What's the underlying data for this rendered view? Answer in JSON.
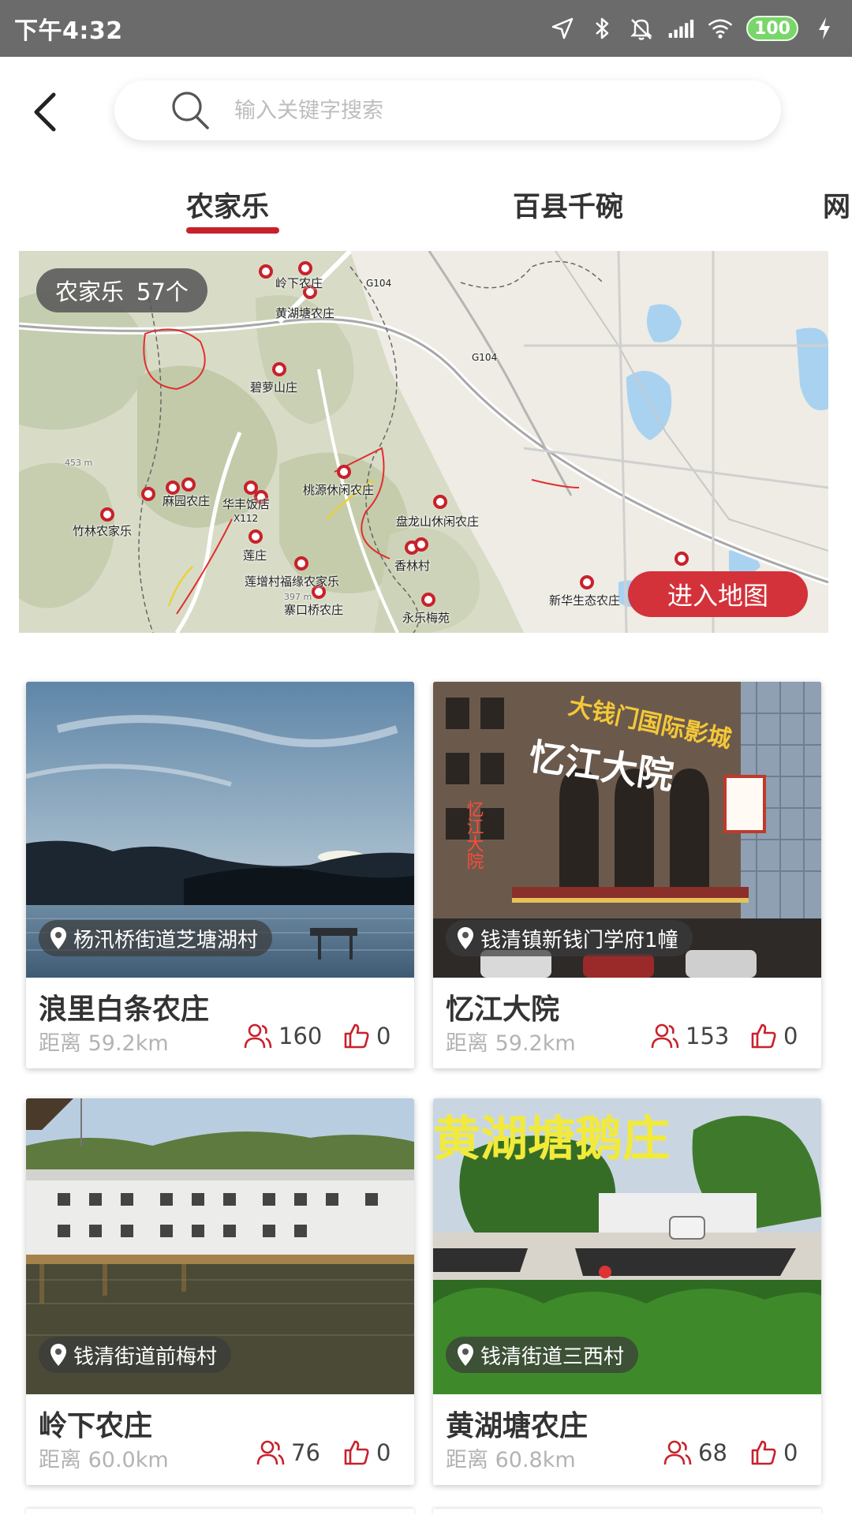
{
  "status_bar": {
    "time": "下午4:32",
    "battery": "100"
  },
  "search": {
    "placeholder": "输入关键字搜索"
  },
  "tabs": [
    {
      "label": "农家乐",
      "active": true
    },
    {
      "label": "百县千碗",
      "active": false
    },
    {
      "label": "网",
      "active": false
    }
  ],
  "map": {
    "count_label": "农家乐",
    "count_value": "57个",
    "enter_label": "进入地图",
    "places": [
      "岭下农庄",
      "黄湖塘农庄",
      "碧萝山庄",
      "麻园农庄",
      "华丰饭店",
      "竹林农家乐",
      "莲庄",
      "桃源休闲农庄",
      "盘龙山休闲农庄",
      "香林村",
      "莲增村福缘农家乐",
      "寨口桥农庄",
      "永乐梅苑",
      "新华生态农庄"
    ],
    "road_labels": [
      "G104",
      "G104",
      "X112"
    ],
    "elevation_labels": [
      "453 m",
      "397 m"
    ]
  },
  "cards": [
    {
      "name": "浪里白条农庄",
      "location": "杨汛桥街道芝塘湖村",
      "distance": "距离 59.2km",
      "visitors": "160",
      "likes": "0"
    },
    {
      "name": "忆江大院",
      "location": "钱清镇新钱门学府1幢",
      "distance": "距离 59.2km",
      "visitors": "153",
      "likes": "0",
      "photo_text": {
        "main": "忆江大院",
        "sign": "大钱门国际影城",
        "side": "忆江大院"
      }
    },
    {
      "name": "岭下农庄",
      "location": "钱清街道前梅村",
      "distance": "距离 60.0km",
      "visitors": "76",
      "likes": "0"
    },
    {
      "name": "黄湖塘农庄",
      "location": "钱清街道三西村",
      "distance": "距离 60.8km",
      "visitors": "68",
      "likes": "0",
      "photo_text": {
        "banner": "黄湖塘鹅庄"
      }
    }
  ],
  "colors": {
    "accent": "#c8212b",
    "status_bar": "#6b6b6b",
    "enter_map": "#d3323a"
  },
  "icons": [
    "location-icon",
    "battery-icon",
    "wifi-icon",
    "signal-icon",
    "bluetooth-icon",
    "mute-icon",
    "charging-icon",
    "back-icon",
    "search-icon",
    "pin-icon",
    "people-icon",
    "thumbs-up-icon"
  ]
}
